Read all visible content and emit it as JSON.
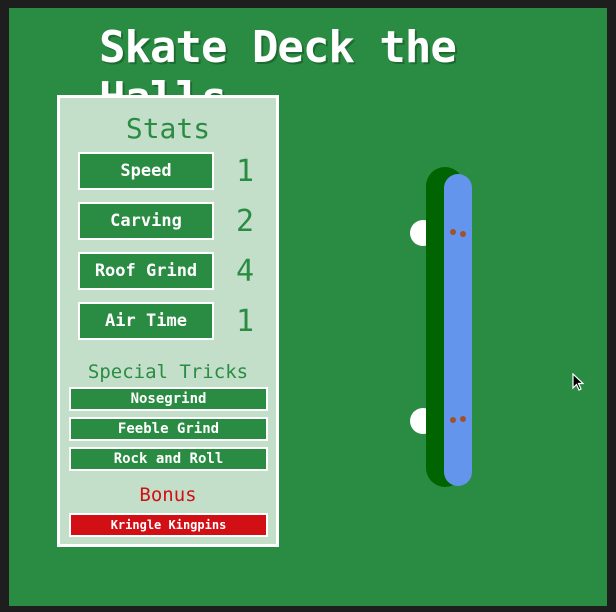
{
  "game": {
    "title": "Skate Deck the Halls",
    "colors": {
      "background": "#2a8c43",
      "panel": "#c3dfc9",
      "accent": "#d10f14",
      "deck": "#6495ed",
      "deck_edge": "#006400",
      "wheel": "#ffffff"
    }
  },
  "stats": {
    "heading": "Stats",
    "items": [
      {
        "label": "Speed",
        "value": "1"
      },
      {
        "label": "Carving",
        "value": "2"
      },
      {
        "label": "Roof Grind",
        "value": "4"
      },
      {
        "label": "Air Time",
        "value": "1"
      }
    ]
  },
  "tricks": {
    "heading": "Special Tricks",
    "items": [
      "Nosegrind",
      "Feeble Grind",
      "Rock and Roll"
    ]
  },
  "bonus": {
    "heading": "Bonus",
    "item": "Kringle Kingpins"
  }
}
